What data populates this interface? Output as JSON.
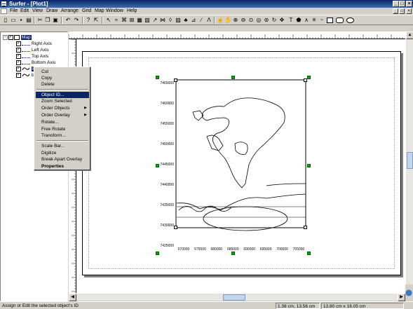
{
  "window": {
    "title": "Surfer - [Plot1]",
    "controls": [
      "_",
      "□",
      "×"
    ]
  },
  "menubar": {
    "items": [
      "File",
      "Edit",
      "View",
      "Draw",
      "Arrange",
      "Grid",
      "Map",
      "Window",
      "Help"
    ],
    "mdi_controls": [
      "_",
      "□",
      "×"
    ]
  },
  "toolbar": {
    "icons": [
      "new-icon",
      "open-icon",
      "save-icon",
      "print-icon",
      "cut-icon",
      "copy-icon",
      "paste-icon",
      "undo-icon",
      "redo-icon",
      "select-icon",
      "pointer-icon",
      "map-icons",
      "zoom-icons",
      "drawing-icons"
    ]
  },
  "object_tree": {
    "items": [
      {
        "label": "Map",
        "selected": true,
        "checked": true
      },
      {
        "label": "Right Axis",
        "checked": true
      },
      {
        "label": "Left Axis",
        "checked": true
      },
      {
        "label": "Top Axis",
        "checked": true
      },
      {
        "label": "Bottom Axis",
        "checked": true
      },
      {
        "label": "B",
        "checked": true
      },
      {
        "label": "b",
        "checked": true
      }
    ]
  },
  "context_menu": {
    "items": [
      {
        "label": "Cut"
      },
      {
        "label": "Copy"
      },
      {
        "label": "Delete"
      },
      {
        "separator": true
      },
      {
        "label": "Object ID...",
        "highlighted": true
      },
      {
        "label": "Zoom Selected"
      },
      {
        "label": "Order Objects",
        "submenu": true
      },
      {
        "label": "Order Overlay",
        "submenu": true
      },
      {
        "label": "Rotate..."
      },
      {
        "label": "Free Rotate"
      },
      {
        "label": "Transform..."
      },
      {
        "separator": true
      },
      {
        "label": "Scale Bar..."
      },
      {
        "label": "Digitize"
      },
      {
        "label": "Break Apart Overlay"
      },
      {
        "label": "Properties",
        "bold": true
      }
    ]
  },
  "map": {
    "y_ticks": [
      "7465000",
      "7460000",
      "7455000",
      "7450000",
      "7445000",
      "7440000",
      "7435000",
      "7430000",
      "7425000"
    ],
    "x_ticks": [
      "670000",
      "675000",
      "680000",
      "685000",
      "690000",
      "695000",
      "700000",
      "705000"
    ]
  },
  "statusbar": {
    "message": "Assign or Edit the selected object's ID",
    "cursor_position": "1.38 cm, 13.56 cm",
    "size": "13.80 cm x 16.05 cm"
  }
}
